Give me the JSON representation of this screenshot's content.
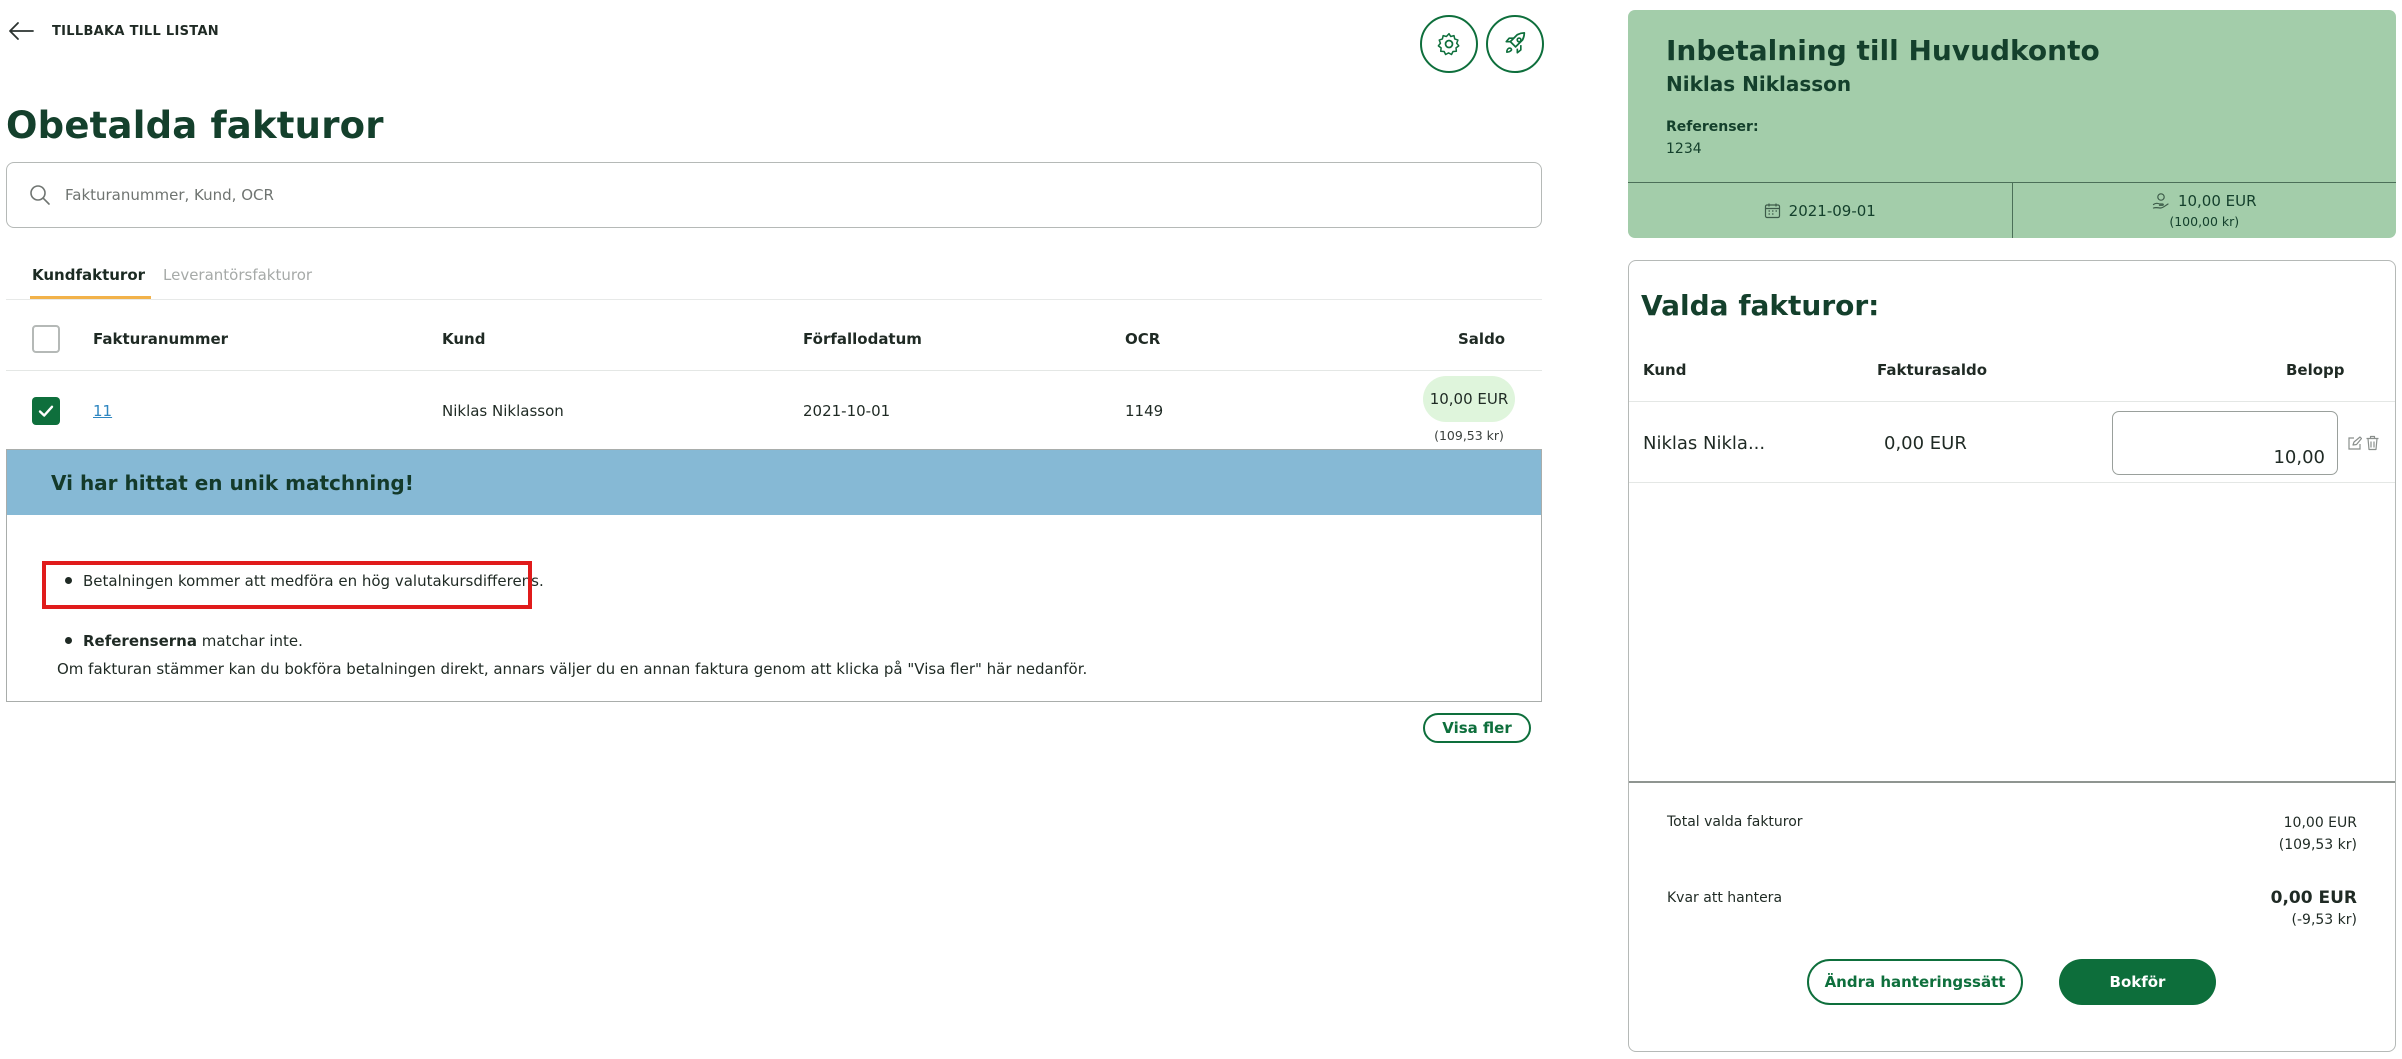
{
  "nav": {
    "back_label": "TILLBAKA TILL LISTAN"
  },
  "page": {
    "title": "Obetalda fakturor"
  },
  "search": {
    "placeholder": "Fakturanummer, Kund, OCR"
  },
  "tabs": [
    {
      "label": "Kundfakturor",
      "active": true
    },
    {
      "label": "Leverantörsfakturor",
      "active": false
    }
  ],
  "table": {
    "headers": {
      "invoice_number": "Fakturanummer",
      "customer": "Kund",
      "due_date": "Förfallodatum",
      "ocr": "OCR",
      "balance": "Saldo"
    },
    "rows": [
      {
        "checked": true,
        "invoice_number": "11",
        "customer": "Niklas Niklasson",
        "due_date": "2021-10-01",
        "ocr": "1149",
        "balance": "10,00 EUR",
        "balance_sek": "(109,53 kr)"
      }
    ]
  },
  "match": {
    "heading": "Vi har hittat en unik matchning!",
    "item1": "Betalningen kommer att medföra en hög valutakursdifferens.",
    "item2_bold": "Referenserna",
    "item2_rest": " matchar inte.",
    "note": "Om fakturan stämmer kan du bokföra betalningen direkt, annars väljer du en annan faktura genom att klicka på \"Visa fler\" här nedanför."
  },
  "show_more_label": "Visa fler",
  "payment": {
    "title": "Inbetalning till Huvudkonto",
    "payer": "Niklas Niklasson",
    "references_label": "Referenser:",
    "references_value": "1234",
    "date": "2021-09-01",
    "amount": "10,00 EUR",
    "amount_sek": "(100,00 kr)"
  },
  "selected": {
    "title": "Valda fakturor:",
    "headers": {
      "customer": "Kund",
      "invoice_balance": "Fakturasaldo",
      "amount": "Belopp"
    },
    "rows": [
      {
        "customer": "Niklas Nikla...",
        "invoice_balance": "0,00 EUR",
        "amount": "10,00"
      }
    ],
    "total_label": "Total valda fakturor",
    "total_value": "10,00 EUR",
    "total_value_sek": "(109,53 kr)",
    "remaining_label": "Kvar att hantera",
    "remaining_value": "0,00 EUR",
    "remaining_value_sek": "(-9,53 kr)",
    "change_method_label": "Ändra hanteringssätt",
    "book_label": "Bokför"
  },
  "colors": {
    "brand_green": "#0e6f3c",
    "payment_card_bg": "#a3cdaa",
    "match_header_bg": "#86b9d5",
    "balance_pill_bg": "#dff5dc",
    "tab_underline": "#f2b24a",
    "highlight_red": "#e01b1b"
  },
  "icons": [
    "arrow-left-icon",
    "gear-icon",
    "rocket-icon",
    "search-icon",
    "check-icon",
    "calendar-icon",
    "money-hand-icon",
    "edit-icon",
    "trash-icon"
  ]
}
